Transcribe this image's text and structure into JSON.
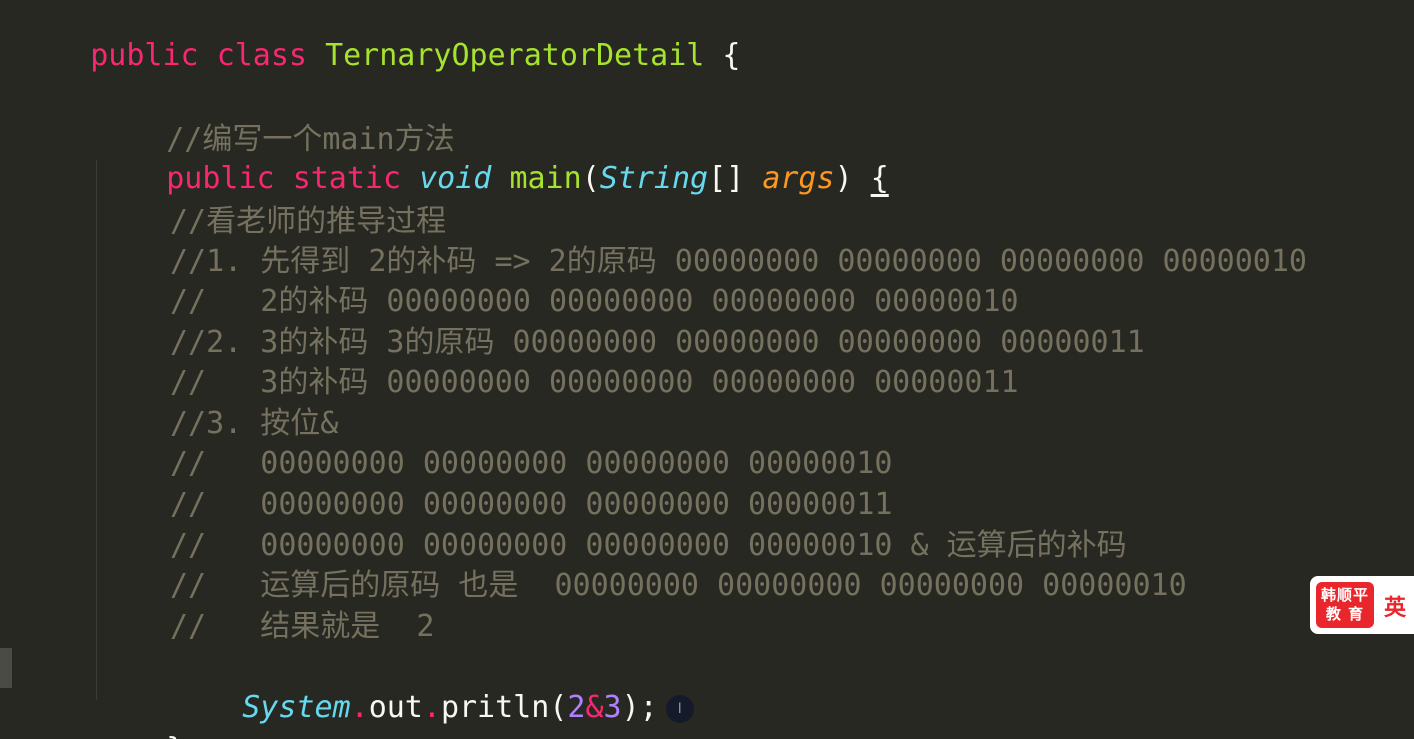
{
  "code": {
    "line1": {
      "kw1": "public",
      "kw2": "class",
      "class_name": "TernaryOperatorDetail",
      "brace": "{"
    },
    "line3": {
      "comment": "//编写一个main方法"
    },
    "line4": {
      "kw1": "public",
      "kw2": "static",
      "type": "void",
      "method": "main",
      "open": "(",
      "ptype": "String",
      "brackets": "[]",
      "param": "args",
      "close": ")",
      "brace": "{"
    },
    "comments": [
      "//看老师的推导过程",
      "//1. 先得到 2的补码 => 2的原码 00000000 00000000 00000000 00000010",
      "//   2的补码 00000000 00000000 00000000 00000010",
      "//2. 3的补码 3的原码 00000000 00000000 00000000 00000011",
      "//   3的补码 00000000 00000000 00000000 00000011",
      "//3. 按位&",
      "//   00000000 00000000 00000000 00000010",
      "//   00000000 00000000 00000000 00000011",
      "//   00000000 00000000 00000000 00000010 & 运算后的补码",
      "//   运算后的原码 也是  00000000 00000000 00000000 00000010",
      "//   结果就是  2"
    ],
    "print_line": {
      "cls": "System",
      "dot1": ".",
      "field": "out",
      "dot2": ".",
      "method": "pritln(",
      "num1": "2",
      "op": "&",
      "num2": "3",
      "end": ");"
    },
    "close_brace": "}",
    "cursor_glyph": "I"
  },
  "logo": {
    "line1": "韩顺平",
    "line2": "教 育",
    "lang": "英"
  },
  "colors": {
    "background": "#272822",
    "keyword": "#f92672",
    "class_name": "#a6e22e",
    "type": "#66d9ef",
    "param": "#fd971f",
    "comment": "#75715e",
    "number": "#ae81ff",
    "logo_red": "#e8262b"
  }
}
